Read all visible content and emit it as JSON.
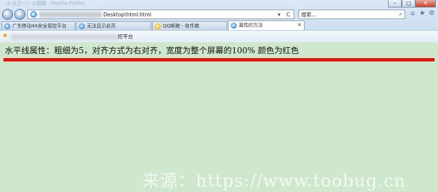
{
  "window": {
    "title": "（3 分之一）· 火狐版 · Mozilla Firefox",
    "min": "–",
    "max": "□",
    "close": "✕"
  },
  "nav": {
    "back": "‹",
    "forward": "›",
    "address": "Desktop\\html.html",
    "address_tools": "▾ C",
    "search_placeholder": "搜索...",
    "search_icon": "⌕",
    "home_icon": "⌂",
    "star_icon": "★",
    "gear_icon": "⚙"
  },
  "tabs": [
    {
      "label": "广东移动4A安全管控平台",
      "active": false
    },
    {
      "label": "无法显示此页",
      "active": false
    },
    {
      "label": "QQ邮箱 - 收件箱",
      "active": false
    },
    {
      "label": "属性的方法",
      "active": true
    }
  ],
  "favorites": {
    "item": "控平台"
  },
  "page": {
    "heading": "水平线属性：粗细为5，对齐方式为右对齐，宽度为整个屏幕的100% 颜色为红色",
    "hr_color": "#e2140f",
    "background": "#cfe8cd",
    "watermark": "来源：https://www.toobug.cn"
  }
}
